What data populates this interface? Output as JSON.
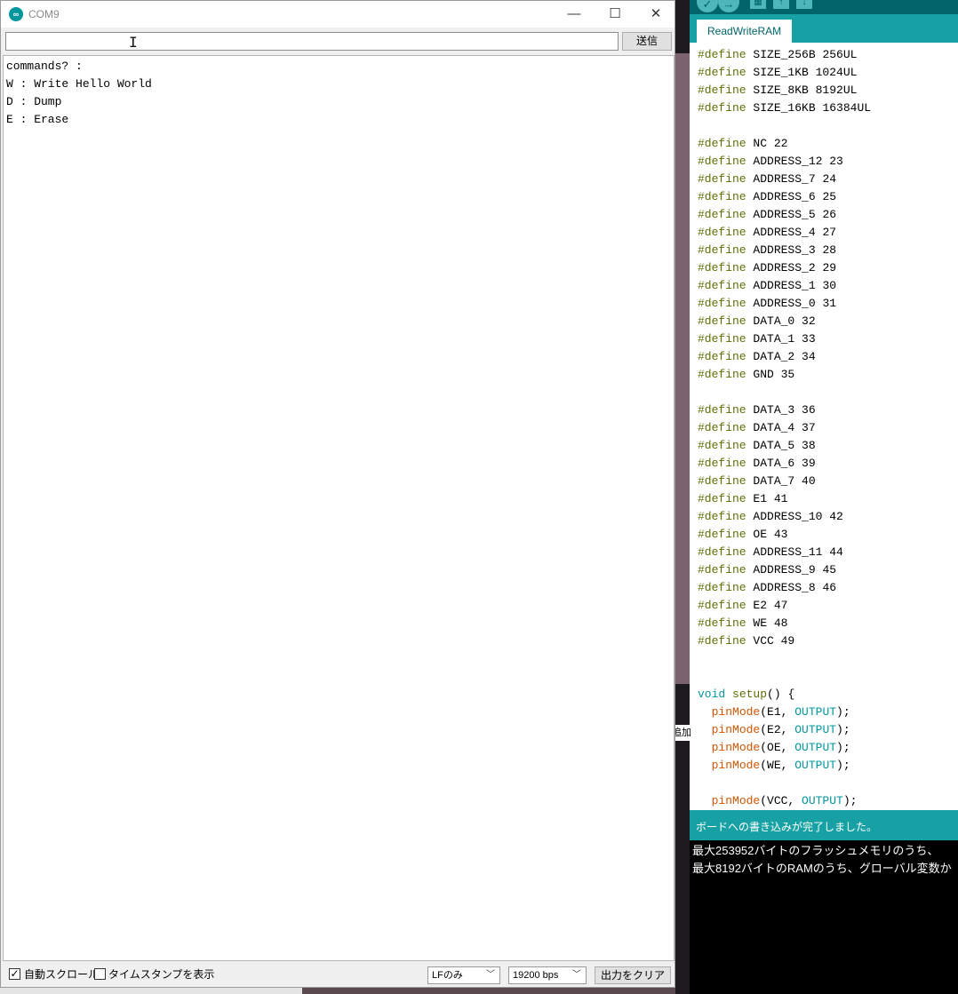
{
  "serial_monitor": {
    "title": "COM9",
    "app_icon": "arduino-icon",
    "window_controls": {
      "minimize": "—",
      "maximize": "☐",
      "close": "✕"
    },
    "send_input_value": "",
    "send_label": "送信",
    "output_lines": [
      "commands? :",
      "W : Write Hello World",
      "D : Dump",
      "E : Erase"
    ],
    "autoscroll": {
      "label": "自動スクロール",
      "checked": true
    },
    "timestamp": {
      "label": "タイムスタンプを表示",
      "checked": false
    },
    "line_ending": "LFのみ",
    "baud_rate": "19200 bps",
    "clear_label": "出力をクリア"
  },
  "ide": {
    "tab_label": "ReadWriteRAM",
    "partial_label": "追加",
    "defines": [
      [
        "SIZE_256B",
        "256UL"
      ],
      [
        "SIZE_1KB",
        "1024UL"
      ],
      [
        "SIZE_8KB",
        "8192UL"
      ],
      [
        "SIZE_16KB",
        "16384UL"
      ],
      null,
      [
        "NC",
        "22"
      ],
      [
        "ADDRESS_12",
        "23"
      ],
      [
        "ADDRESS_7",
        "24"
      ],
      [
        "ADDRESS_6",
        "25"
      ],
      [
        "ADDRESS_5",
        "26"
      ],
      [
        "ADDRESS_4",
        "27"
      ],
      [
        "ADDRESS_3",
        "28"
      ],
      [
        "ADDRESS_2",
        "29"
      ],
      [
        "ADDRESS_1",
        "30"
      ],
      [
        "ADDRESS_0",
        "31"
      ],
      [
        "DATA_0",
        "32"
      ],
      [
        "DATA_1",
        "33"
      ],
      [
        "DATA_2",
        "34"
      ],
      [
        "GND",
        "35"
      ],
      null,
      [
        "DATA_3",
        "36"
      ],
      [
        "DATA_4",
        "37"
      ],
      [
        "DATA_5",
        "38"
      ],
      [
        "DATA_6",
        "39"
      ],
      [
        "DATA_7",
        "40"
      ],
      [
        "E1",
        "41"
      ],
      [
        "ADDRESS_10",
        "42"
      ],
      [
        "OE",
        "43"
      ],
      [
        "ADDRESS_11",
        "44"
      ],
      [
        "ADDRESS_9",
        "45"
      ],
      [
        "ADDRESS_8",
        "46"
      ],
      [
        "E2",
        "47"
      ],
      [
        "WE",
        "48"
      ],
      [
        "VCC",
        "49"
      ]
    ],
    "define_keyword": "#define",
    "setup": {
      "void": "void",
      "name": "setup",
      "signature_rest": "() {",
      "calls": [
        [
          "E1",
          "OUTPUT"
        ],
        [
          "E2",
          "OUTPUT"
        ],
        [
          "OE",
          "OUTPUT"
        ],
        [
          "WE",
          "OUTPUT"
        ],
        null,
        [
          "VCC",
          "OUTPUT"
        ]
      ],
      "fn": "pinMode"
    },
    "status_message": "ボードへの書き込みが完了しました。",
    "console_lines": [
      "最大253952バイトのフラッシュメモリのうち、",
      "最大8192バイトのRAMのうち、グローバル変数か"
    ],
    "colors": {
      "toolbar": "#006468",
      "tabbar": "#17a1a5",
      "define": "#5e6d03",
      "keyword": "#00979c",
      "function": "#d35400"
    }
  }
}
